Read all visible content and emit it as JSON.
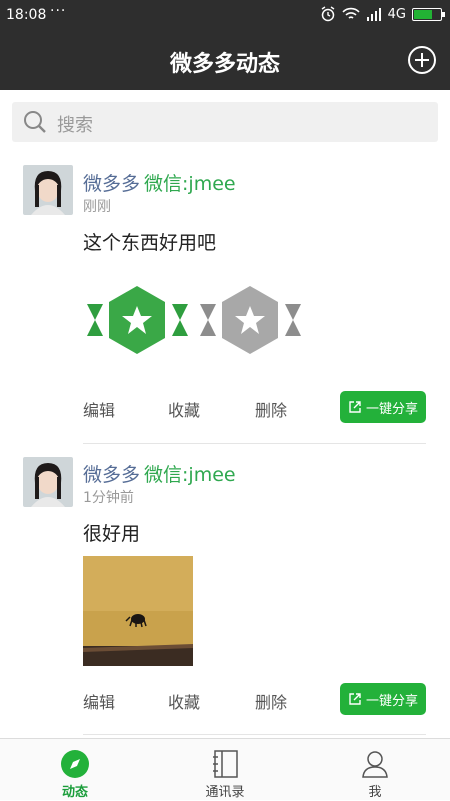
{
  "status_bar": {
    "time": "18:08",
    "dots": "···",
    "network": "4G"
  },
  "header": {
    "title": "微多多动态"
  },
  "search": {
    "placeholder": "搜索"
  },
  "posts": [
    {
      "author": "微多多",
      "wechat": "微信:jmee",
      "time": "刚刚",
      "text": "这个东西好用吧",
      "actions": {
        "edit": "编辑",
        "favorite": "收藏",
        "delete": "删除",
        "share": "一键分享"
      }
    },
    {
      "author": "微多多",
      "wechat": "微信:jmee",
      "time": "1分钟前",
      "text": "很好用",
      "actions": {
        "edit": "编辑",
        "favorite": "收藏",
        "delete": "删除",
        "share": "一键分享"
      }
    }
  ],
  "tabbar": {
    "tab1": "动态",
    "tab2": "通讯录",
    "tab3": "我"
  },
  "colors": {
    "accent": "#23b13a",
    "header_bg": "#2e2e2e",
    "name_blue": "#566d96"
  }
}
